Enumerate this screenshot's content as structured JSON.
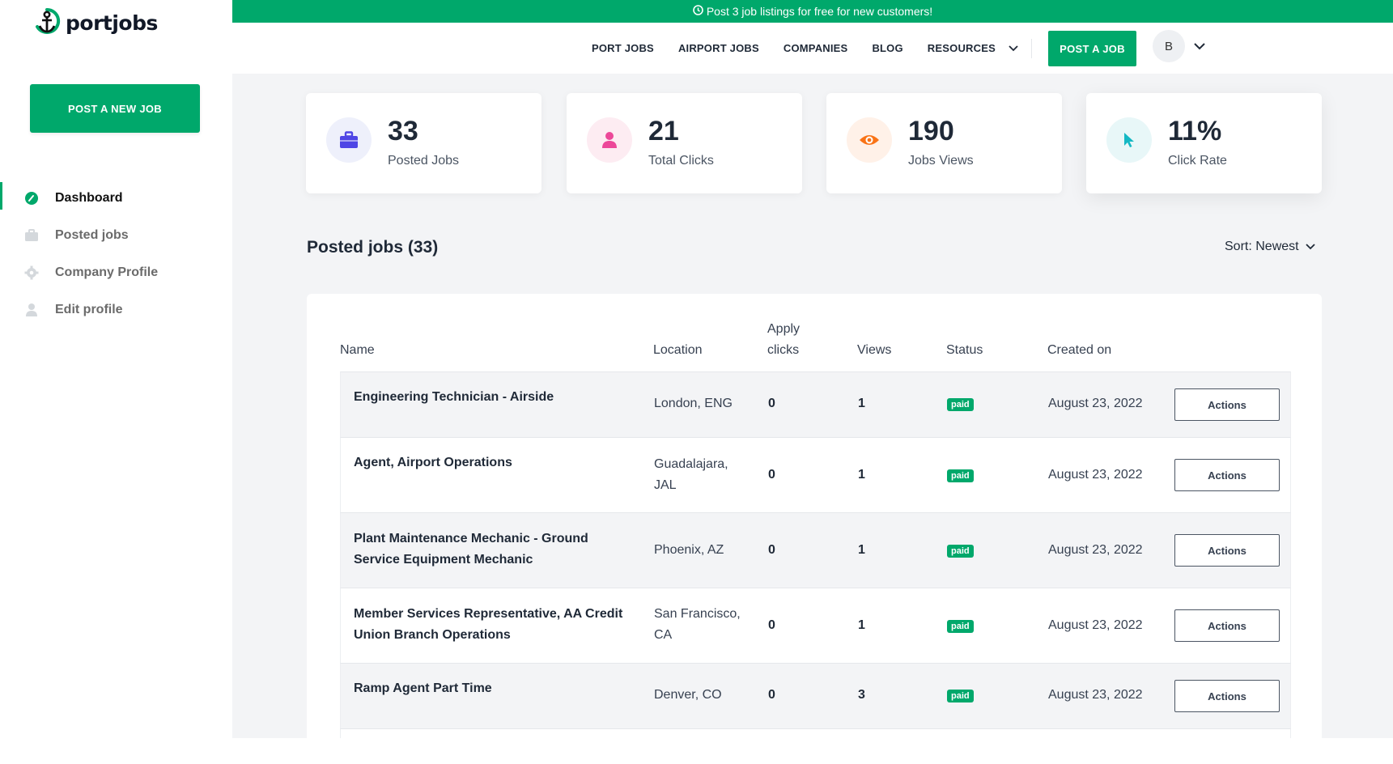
{
  "brand": {
    "name": "portjobs",
    "accent": "#00a86b"
  },
  "sidebar": {
    "post_new_label": "POST A NEW JOB",
    "items": [
      {
        "label": "Dashboard",
        "icon": "dashboard-gauge-icon",
        "active": true
      },
      {
        "label": "Posted jobs",
        "icon": "briefcase-icon",
        "active": false
      },
      {
        "label": "Company Profile",
        "icon": "gear-icon",
        "active": false
      },
      {
        "label": "Edit profile",
        "icon": "user-icon",
        "active": false
      }
    ]
  },
  "promo": {
    "text": "Post 3 job listings for free for new customers!",
    "icon": "clock-icon"
  },
  "topnav": {
    "links": [
      "PORT JOBS",
      "AIRPORT JOBS",
      "COMPANIES",
      "BLOG",
      "RESOURCES"
    ],
    "post_job_label": "POST A JOB",
    "avatar_initial": "B"
  },
  "stats": [
    {
      "value": "33",
      "label": "Posted Jobs",
      "icon": "briefcase-icon",
      "color": "#4f46e5",
      "bg": "#eef0fb"
    },
    {
      "value": "21",
      "label": "Total Clicks",
      "icon": "user-icon",
      "color": "#ec4899",
      "bg": "#fdecf2"
    },
    {
      "value": "190",
      "label": "Jobs Views",
      "icon": "eye-icon",
      "color": "#f97316",
      "bg": "#fff1e8"
    },
    {
      "value": "11%",
      "label": "Click Rate",
      "icon": "cursor-icon",
      "color": "#14b8c4",
      "bg": "#e8f7f8"
    }
  ],
  "posted": {
    "title": "Posted jobs (33)",
    "sort_label": "Sort: Newest",
    "headers": {
      "name": "Name",
      "location": "Location",
      "apply_1": "Apply",
      "apply_2": "clicks",
      "views": "Views",
      "status": "Status",
      "created": "Created on"
    },
    "rows": [
      {
        "name": "Engineering Technician - Airside",
        "location": "London, ENG",
        "clicks": "0",
        "views": "1",
        "status": "paid",
        "created": "August 23, 2022",
        "action": "Actions"
      },
      {
        "name": "Agent, Airport Operations",
        "location": "Guadalajara, JAL",
        "clicks": "0",
        "views": "1",
        "status": "paid",
        "created": "August 23, 2022",
        "action": "Actions"
      },
      {
        "name": "Plant Maintenance Mechanic - Ground Service Equipment Mechanic",
        "location": "Phoenix, AZ",
        "clicks": "0",
        "views": "1",
        "status": "paid",
        "created": "August 23, 2022",
        "action": "Actions"
      },
      {
        "name": "Member Services Representative, AA Credit Union Branch Operations",
        "location": "San Francisco, CA",
        "clicks": "0",
        "views": "1",
        "status": "paid",
        "created": "August 23, 2022",
        "action": "Actions"
      },
      {
        "name": "Ramp Agent Part Time",
        "location": "Denver, CO",
        "clicks": "0",
        "views": "3",
        "status": "paid",
        "created": "August 23, 2022",
        "action": "Actions"
      }
    ]
  }
}
